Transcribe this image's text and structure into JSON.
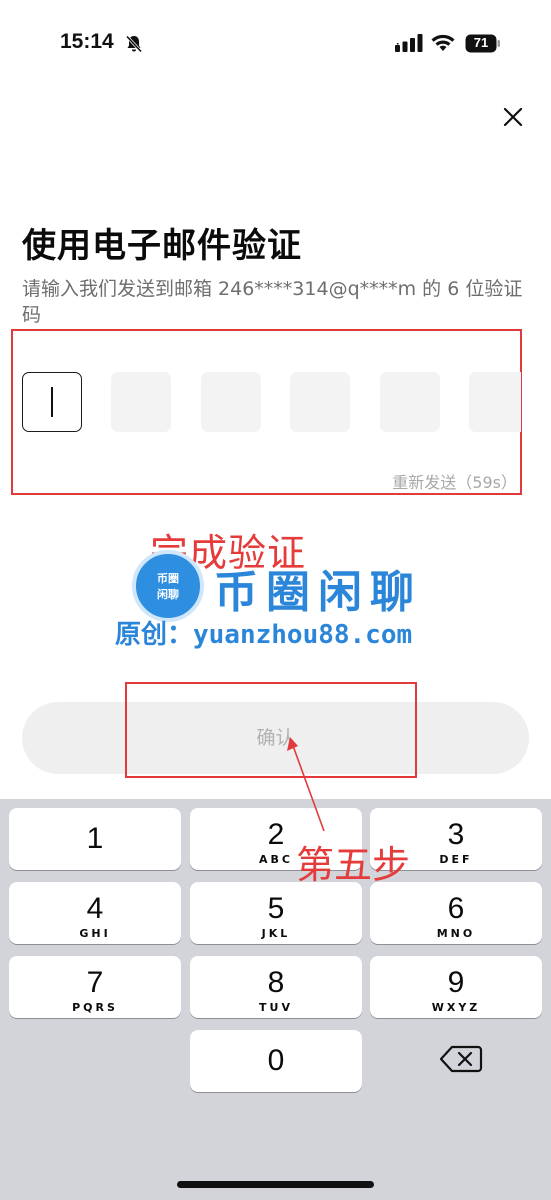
{
  "status_bar": {
    "time": "15:14",
    "battery": "71",
    "icons": [
      "bell-slash-icon",
      "signal-icon",
      "wifi-icon",
      "battery-icon"
    ]
  },
  "header": {
    "close_icon": "close-icon"
  },
  "main": {
    "title": "使用电子邮件验证",
    "subtitle": "请输入我们发送到邮箱 246****314@q****m 的 6 位验证码",
    "code_boxes": [
      "",
      "",
      "",
      "",
      "",
      ""
    ],
    "active_box": 0,
    "resend_label": "重新发送（59s）",
    "confirm_label": "确认"
  },
  "annotations": {
    "step_done": "完成验证",
    "step_five": "第五步",
    "color": "#e23a3a"
  },
  "watermark": {
    "logo_line1": "币圈",
    "logo_line2": "闲聊",
    "title": "币圈闲聊",
    "url": "原创：yuanzhou88.com",
    "color": "#2b86d9"
  },
  "keyboard": {
    "keys": [
      {
        "num": "1",
        "letters": ""
      },
      {
        "num": "2",
        "letters": "ABC"
      },
      {
        "num": "3",
        "letters": "DEF"
      },
      {
        "num": "4",
        "letters": "GHI"
      },
      {
        "num": "5",
        "letters": "JKL"
      },
      {
        "num": "6",
        "letters": "MNO"
      },
      {
        "num": "7",
        "letters": "PQRS"
      },
      {
        "num": "8",
        "letters": "TUV"
      },
      {
        "num": "9",
        "letters": "WXYZ"
      },
      {
        "num": "0",
        "letters": ""
      }
    ],
    "delete_icon": "backspace-icon"
  }
}
